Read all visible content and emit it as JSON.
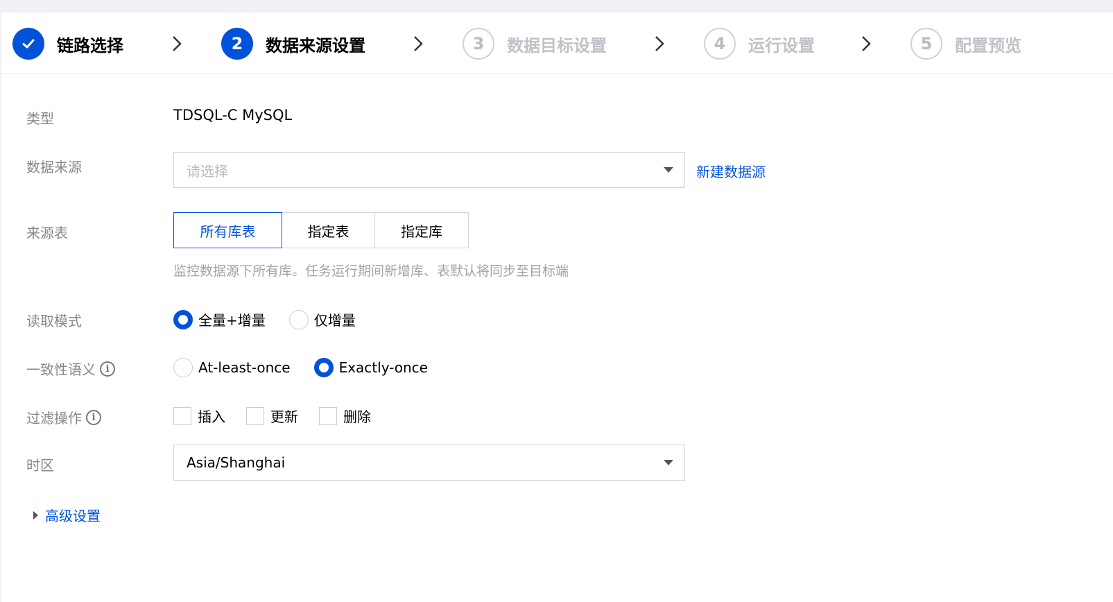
{
  "steps": [
    {
      "number": "✓",
      "label": "链路选择",
      "state": "done"
    },
    {
      "number": "2",
      "label": "数据来源设置",
      "state": "active"
    },
    {
      "number": "3",
      "label": "数据目标设置",
      "state": "todo"
    },
    {
      "number": "4",
      "label": "运行设置",
      "state": "todo"
    },
    {
      "number": "5",
      "label": "配置预览",
      "state": "todo"
    }
  ],
  "form": {
    "type": {
      "label": "类型",
      "value": "TDSQL-C MySQL"
    },
    "source": {
      "label": "数据来源",
      "placeholder": "请选择",
      "new_link": "新建数据源"
    },
    "source_table": {
      "label": "来源表",
      "options": [
        "所有库表",
        "指定表",
        "指定库"
      ],
      "selected": "所有库表",
      "help": "监控数据源下所有库。任务运行期间新增库、表默认将同步至目标端"
    },
    "read_mode": {
      "label": "读取模式",
      "options": [
        "全量+增量",
        "仅增量"
      ],
      "selected": "全量+增量"
    },
    "consistency": {
      "label": "一致性语义",
      "options": [
        "At-least-once",
        "Exactly-once"
      ],
      "selected": "Exactly-once"
    },
    "filter_ops": {
      "label": "过滤操作",
      "options": [
        "插入",
        "更新",
        "删除"
      ],
      "checked": []
    },
    "timezone": {
      "label": "时区",
      "value": "Asia/Shanghai"
    },
    "advanced": {
      "label": "高级设置"
    }
  },
  "colors": {
    "accent": "#0052d9",
    "muted": "#888888",
    "border": "#d0d3d9"
  }
}
